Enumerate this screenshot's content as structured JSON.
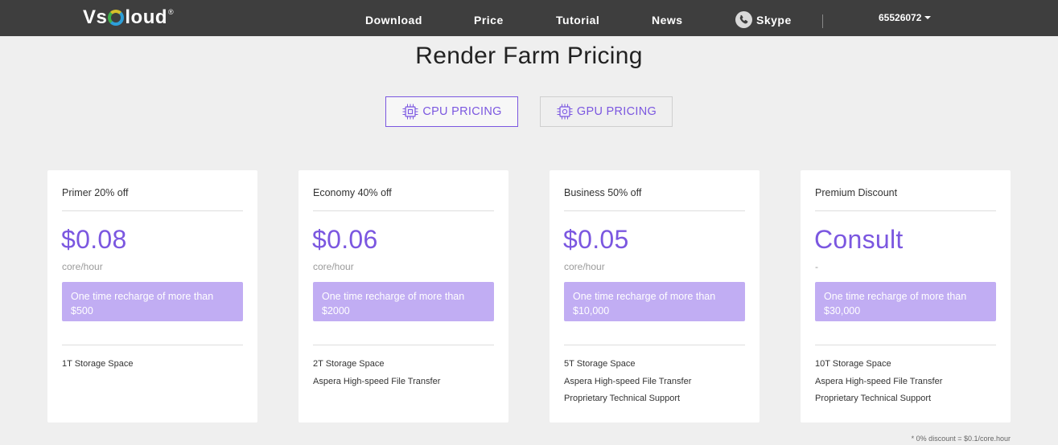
{
  "header": {
    "logo_left": "Vs",
    "logo_right": "loud",
    "logo_mark": "®",
    "nav": [
      {
        "label": "Download"
      },
      {
        "label": "Price"
      },
      {
        "label": "Tutorial"
      },
      {
        "label": "News"
      },
      {
        "label": "Skype",
        "icon": "phone-icon"
      }
    ],
    "user": "65526072",
    "background_color": "#3e3e3e"
  },
  "page_title": "Render Farm Pricing",
  "tabs": [
    {
      "label": "CPU PRICING",
      "icon": "cpu-chip-icon",
      "active": true
    },
    {
      "label": "GPU PRICING",
      "icon": "gpu-chip-icon",
      "active": false
    }
  ],
  "accent_color": "#7b57e0",
  "plans": [
    {
      "title": "Primer 20% off",
      "price": "$0.08",
      "unit": "core/hour",
      "recharge": "One time recharge of more than $500",
      "features": [
        "1T Storage Space"
      ]
    },
    {
      "title": "Economy 40% off",
      "price": "$0.06",
      "unit": "core/hour",
      "recharge": "One time recharge of more than $2000",
      "features": [
        "2T Storage Space",
        "Aspera High-speed File Transfer"
      ]
    },
    {
      "title": "Business 50% off",
      "price": "$0.05",
      "unit": "core/hour",
      "recharge": "One time recharge of more than $10,000",
      "features": [
        "5T Storage Space",
        "Aspera High-speed File Transfer",
        "Proprietary Technical Support"
      ]
    },
    {
      "title": "Premium Discount",
      "price": "Consult",
      "unit": "-",
      "recharge": "One time recharge of more than $30,000",
      "features": [
        "10T Storage Space",
        "Aspera High-speed File Transfer",
        "Proprietary Technical Support"
      ]
    }
  ],
  "footnote": "* 0% discount = $0.1/core.hour"
}
